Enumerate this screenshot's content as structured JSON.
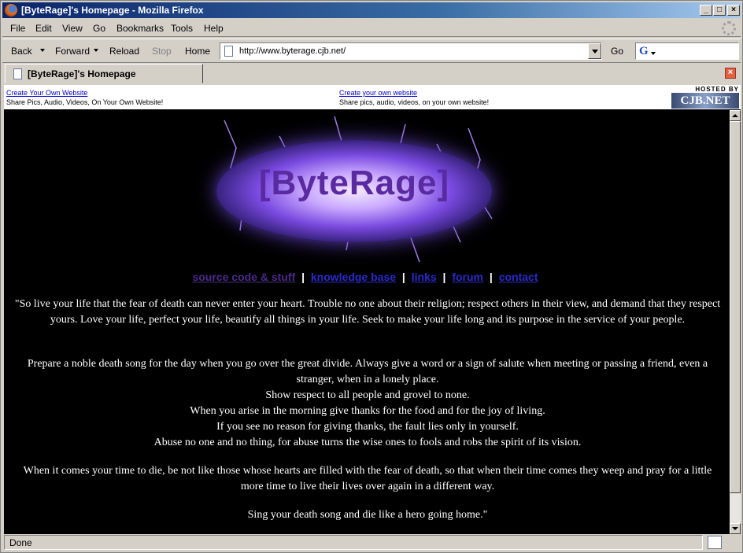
{
  "window": {
    "title": "[ByteRage]'s Homepage - Mozilla Firefox",
    "controls": {
      "minimize": "_",
      "maximize": "□",
      "close": "×"
    }
  },
  "menu": [
    "File",
    "Edit",
    "View",
    "Go",
    "Bookmarks",
    "Tools",
    "Help"
  ],
  "toolbar": {
    "back": "Back",
    "forward": "Forward",
    "reload": "Reload",
    "stop": "Stop",
    "home": "Home",
    "url": "http://www.byterage.cjb.net/",
    "go": "Go"
  },
  "tab": {
    "label": "[ByteRage]'s Homepage"
  },
  "ads": {
    "left": {
      "link": "Create Your Own Website",
      "text": "Share Pics, Audio, Videos, On Your Own Website!"
    },
    "right": {
      "link": "Create your own website",
      "text": "Share pics, audio, videos, on your own website!"
    },
    "logo_hosted": "HOSTED BY",
    "logo_mark": "CJB.NET"
  },
  "page": {
    "logo": "[ByteRage]",
    "nav": [
      "source code & stuff",
      "knowledge base",
      "links",
      "forum",
      "contact"
    ],
    "nav_separator": "|",
    "quote": {
      "p1": "\"So live your life that the fear of death can never enter your heart. Trouble no one about their religion; respect others in their view, and demand that they respect yours. Love your life, perfect your life, beautify all things in your life. Seek to make your life long and its purpose in the service of your people.",
      "p2": [
        "Prepare a noble death song for the day when you go over the great divide. Always give a word or a sign of salute when meeting or passing a friend, even a stranger, when in a lonely place.",
        "Show respect to all people and grovel to none.",
        "When you arise in the morning give thanks for the food and for the joy of living.",
        "If you see no reason for giving thanks, the fault lies only in yourself.",
        "Abuse no one and no thing, for abuse turns the wise ones to fools and robs the spirit of its vision."
      ],
      "p3": "When it comes your time to die, be not like those whose hearts are filled with the fear of death, so that when their time comes they weep and pray for a little more time to live their lives over again in a different way.",
      "p4": "Sing your death song and die like a hero going home.\""
    }
  },
  "status": {
    "text": "Done"
  },
  "colors": {
    "titlebar": "#0a246a",
    "visited_link": "#4a2a8a",
    "link": "#2a2acc",
    "background": "#000000"
  }
}
